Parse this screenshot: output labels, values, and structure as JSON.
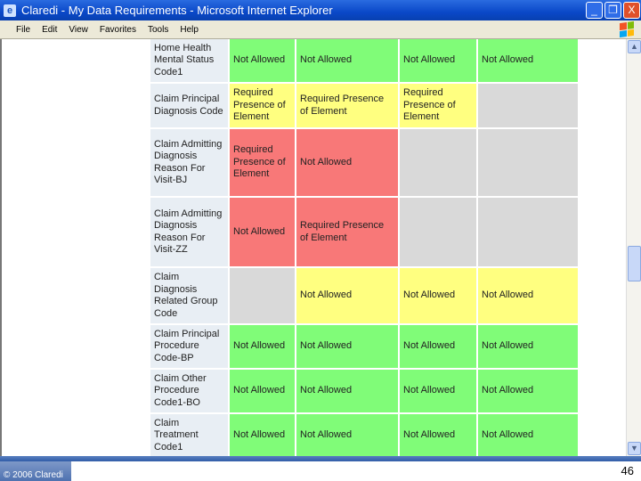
{
  "window": {
    "title": "Claredi - My Data Requirements - Microsoft Internet Explorer",
    "buttons": {
      "minimize": "_",
      "restore": "❐",
      "close": "X"
    }
  },
  "menu": [
    "File",
    "Edit",
    "View",
    "Favorites",
    "Tools",
    "Help"
  ],
  "colors": {
    "green": "#80fc78",
    "yellow": "#ffff80",
    "red": "#f87878",
    "gray": "#d9d9d9",
    "label": "#e8eef4"
  },
  "rows": [
    {
      "label": "Home Health Mental Status Code1",
      "cells": [
        {
          "c": "G",
          "t": "Not Allowed"
        },
        {
          "c": "G",
          "t": "Not Allowed"
        },
        {
          "c": "G",
          "t": "Not Allowed"
        },
        {
          "c": "G",
          "t": "Not Allowed"
        }
      ]
    },
    {
      "label": "Claim Principal Diagnosis Code",
      "cells": [
        {
          "c": "Y",
          "t": "Required Presence of Element"
        },
        {
          "c": "Y",
          "t": "Required Presence of Element"
        },
        {
          "c": "Y",
          "t": "Required Presence of Element"
        },
        {
          "c": "X",
          "t": ""
        }
      ]
    },
    {
      "label": "Claim Admitting Diagnosis Reason For Visit-BJ",
      "cells": [
        {
          "c": "R",
          "t": "Required Presence of Element"
        },
        {
          "c": "R",
          "t": "Not Allowed"
        },
        {
          "c": "X",
          "t": ""
        },
        {
          "c": "X",
          "t": ""
        }
      ]
    },
    {
      "label": "Claim Admitting Diagnosis Reason For Visit-ZZ",
      "cells": [
        {
          "c": "R",
          "t": "Not Allowed"
        },
        {
          "c": "R",
          "t": "Required Presence of Element"
        },
        {
          "c": "X",
          "t": ""
        },
        {
          "c": "X",
          "t": ""
        }
      ]
    },
    {
      "label": "Claim Diagnosis Related Group Code",
      "cells": [
        {
          "c": "X",
          "t": ""
        },
        {
          "c": "Y",
          "t": "Not Allowed"
        },
        {
          "c": "Y",
          "t": "Not Allowed"
        },
        {
          "c": "Y",
          "t": "Not Allowed"
        }
      ]
    },
    {
      "label": "Claim Principal Procedure Code-BP",
      "cells": [
        {
          "c": "G",
          "t": "Not Allowed"
        },
        {
          "c": "G",
          "t": "Not Allowed"
        },
        {
          "c": "G",
          "t": "Not Allowed"
        },
        {
          "c": "G",
          "t": "Not Allowed"
        }
      ]
    },
    {
      "label": "Claim Other Procedure Code1-BO",
      "cells": [
        {
          "c": "G",
          "t": "Not Allowed"
        },
        {
          "c": "G",
          "t": "Not Allowed"
        },
        {
          "c": "G",
          "t": "Not Allowed"
        },
        {
          "c": "G",
          "t": "Not Allowed"
        }
      ]
    },
    {
      "label": "Claim Treatment Code1",
      "cells": [
        {
          "c": "G",
          "t": "Not Allowed"
        },
        {
          "c": "G",
          "t": "Not Allowed"
        },
        {
          "c": "G",
          "t": "Not Allowed"
        },
        {
          "c": "G",
          "t": "Not Allowed"
        }
      ]
    }
  ],
  "footer": {
    "copyright": "© 2006 Claredi",
    "page_number": "46"
  }
}
